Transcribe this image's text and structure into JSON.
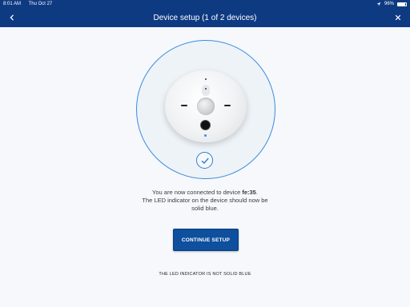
{
  "status_bar": {
    "time": "8:01 AM",
    "date": "Thu Oct 27",
    "battery": "96%"
  },
  "header": {
    "title": "Device setup (1 of 2 devices)",
    "back_icon": "chevron-left-icon",
    "close_icon": "close-icon"
  },
  "message": {
    "line1_prefix": "You are now connected to device ",
    "device_id": "fe:35",
    "line1_suffix": ".",
    "line2": "The LED indicator on the device should now be",
    "line3": "solid blue."
  },
  "buttons": {
    "continue_label": "CONTINUE SETUP",
    "led_not_solid_label": "THE LED INDICATOR IS NOT SOLID BLUE"
  },
  "colors": {
    "brand": "#0e3a82",
    "accent": "#3b8be0",
    "button": "#0e4f9e"
  }
}
